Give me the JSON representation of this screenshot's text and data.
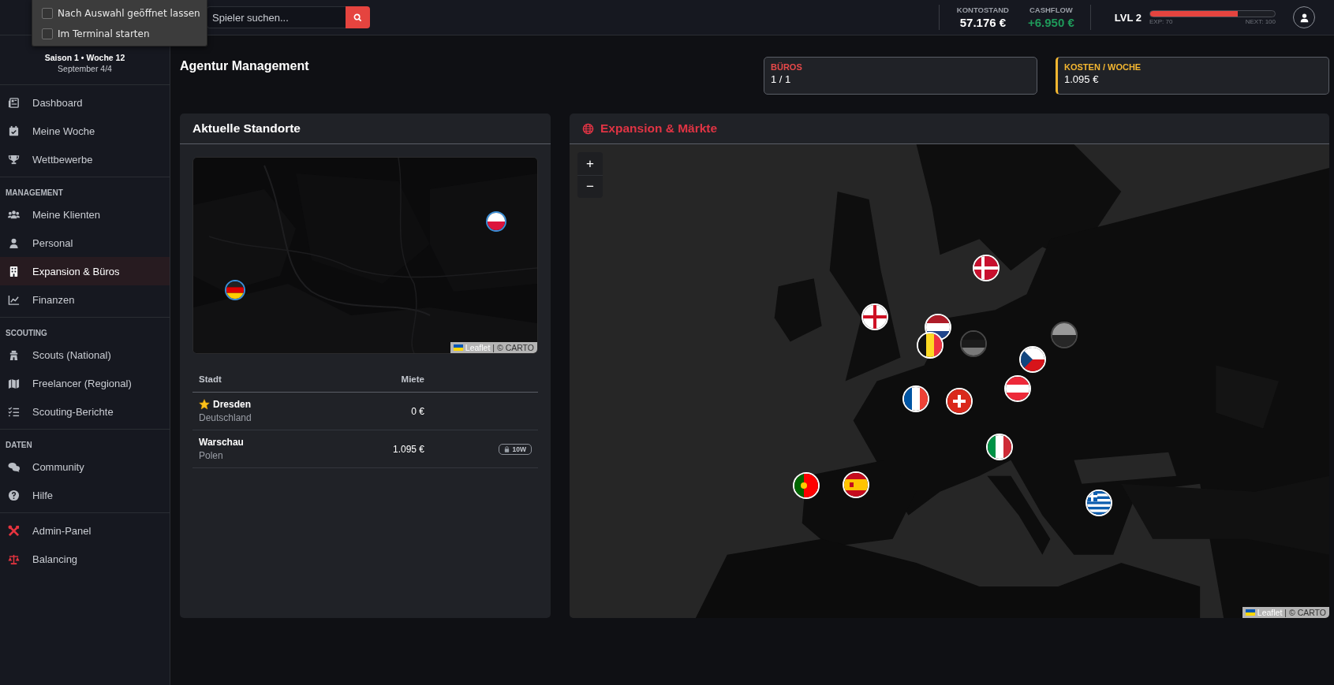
{
  "popup_menu": {
    "items": [
      {
        "label": "Nach Auswahl geöffnet lassen",
        "checked": false
      },
      {
        "label": "Im Terminal starten",
        "checked": false
      }
    ]
  },
  "top_bar": {
    "search": {
      "placeholder": "Spieler suchen..."
    },
    "stats": [
      {
        "label": "KONTOSTAND",
        "value": "57.176 €",
        "kind": "neutral"
      },
      {
        "label": "CASHFLOW",
        "value": "+6.950 €",
        "kind": "positive"
      }
    ],
    "level": {
      "label": "LVL 2",
      "level": 0.7,
      "exp": "EXP: 70",
      "next": "NEXT: 100"
    }
  },
  "sidebar": {
    "season": "Saison 1 • Woche 12",
    "date": "September 4/4",
    "groups": [
      {
        "items": [
          {
            "label": "Dashboard",
            "selected": false,
            "kind": "nav"
          },
          {
            "label": "Meine Woche",
            "selected": false,
            "kind": "nav"
          },
          {
            "label": "Wettbewerbe",
            "selected": false,
            "kind": "nav"
          }
        ]
      },
      {
        "heading": "MANAGEMENT",
        "items": [
          {
            "label": "Meine Klienten",
            "selected": false,
            "kind": "nav"
          },
          {
            "label": "Personal",
            "selected": false,
            "kind": "nav"
          },
          {
            "label": "Expansion & Büros",
            "selected": true,
            "kind": "nav"
          },
          {
            "label": "Finanzen",
            "selected": false,
            "kind": "nav"
          }
        ]
      },
      {
        "heading": "SCOUTING",
        "items": [
          {
            "label": "Scouts (National)",
            "selected": false,
            "kind": "nav"
          },
          {
            "label": "Freelancer (Regional)",
            "selected": false,
            "kind": "nav"
          },
          {
            "label": "Scouting-Berichte",
            "selected": false,
            "kind": "nav"
          }
        ]
      },
      {
        "heading": "DATEN",
        "items": [
          {
            "label": "Community",
            "selected": false,
            "kind": "nav"
          },
          {
            "label": "Hilfe",
            "selected": false,
            "kind": "nav"
          }
        ]
      },
      {
        "items": [
          {
            "label": "Admin-Panel",
            "selected": false,
            "kind": "admin"
          },
          {
            "label": "Balancing",
            "selected": false,
            "kind": "admin"
          }
        ]
      }
    ]
  },
  "page": {
    "title": "Agentur Management",
    "summary_cards": [
      {
        "label": "BÜROS",
        "value": "1 / 1",
        "color": "#e8494a",
        "highlighted": false
      },
      {
        "label": "KOSTEN / WOCHE",
        "value": "1.095 €",
        "color": "#f4b731",
        "highlighted": true
      }
    ]
  },
  "locations_card": {
    "title": "Aktuelle Standorte",
    "map": {
      "attribution_link": "Leaflet",
      "attribution": "| © CARTO"
    },
    "table": {
      "columns": [
        "Stadt",
        "Miete"
      ],
      "rows": [
        {
          "city": "Dresden",
          "country": "Deutschland",
          "rent": "0 €",
          "headquarters": true
        },
        {
          "city": "Warschau",
          "country": "Polen",
          "rent": "1.095 €",
          "headquarters": false,
          "badge": "10W"
        }
      ]
    }
  },
  "expansion_card": {
    "title": "Expansion & Märkte",
    "map": {
      "zoom_in": "+",
      "zoom_out": "−",
      "attribution_link": "Leaflet",
      "attribution": "| © CARTO",
      "markers": [
        {
          "disabled": false
        },
        {
          "disabled": false
        },
        {
          "disabled": false
        },
        {
          "disabled": false
        },
        {
          "disabled": true
        },
        {
          "disabled": true
        },
        {
          "disabled": false
        },
        {
          "disabled": false
        },
        {
          "disabled": false
        },
        {
          "disabled": false
        },
        {
          "disabled": false
        },
        {
          "disabled": false
        },
        {
          "disabled": false
        },
        {
          "disabled": false
        }
      ]
    }
  }
}
